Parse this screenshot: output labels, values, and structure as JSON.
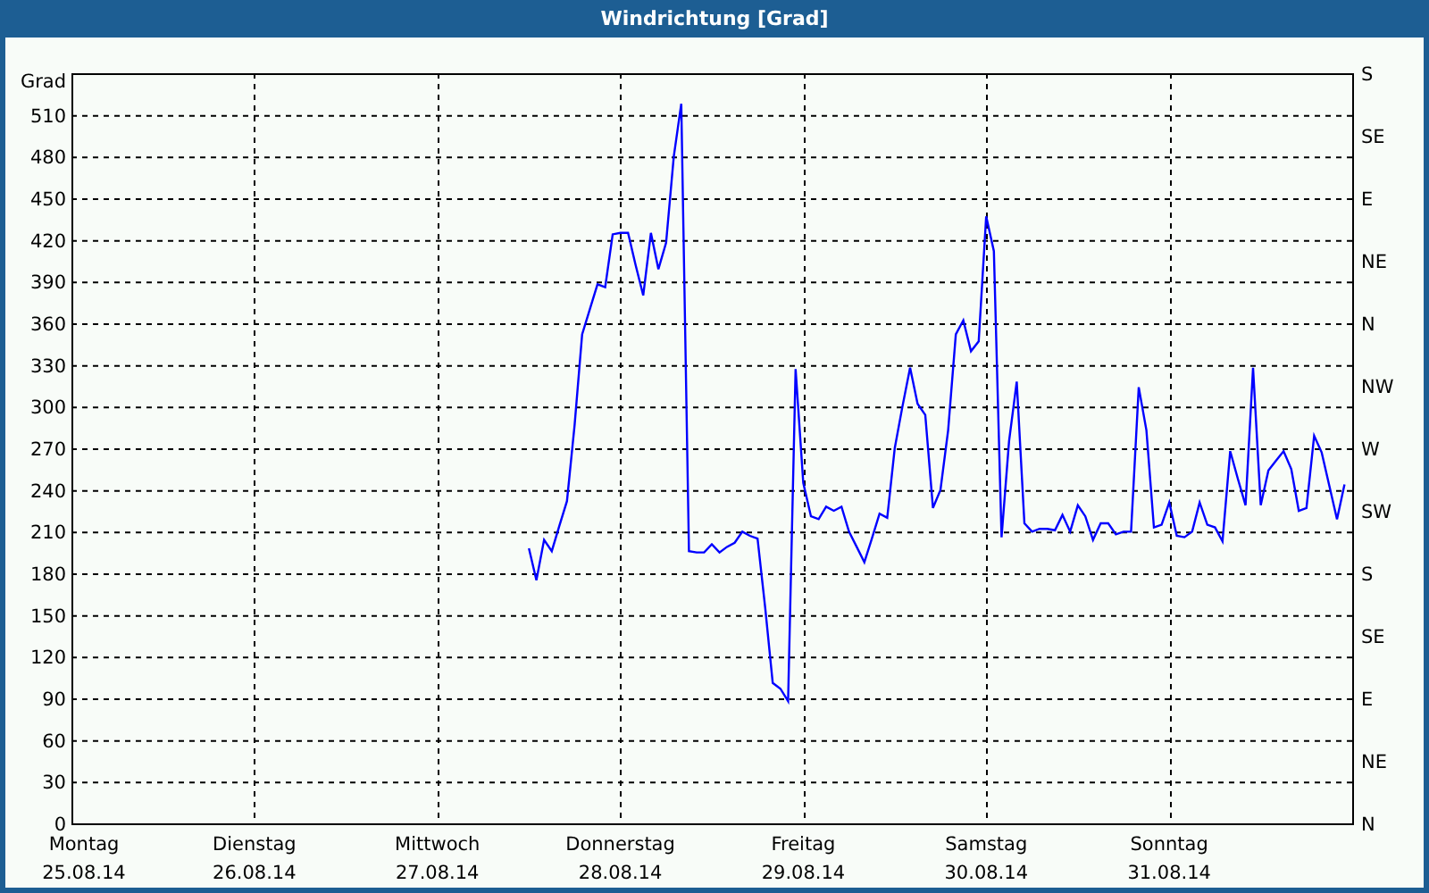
{
  "window": {
    "title": "Windrichtung [Grad]"
  },
  "x_axis_dates": [
    "25.08.14",
    "26.08.14",
    "27.08.14",
    "28.08.14",
    "29.08.14",
    "30.08.14",
    "31.08.14"
  ],
  "compass_labels": [
    "S",
    "SE",
    "E",
    "NE",
    "N",
    "NW",
    "W",
    "SW",
    "S",
    "SE",
    "E",
    "NE",
    "N"
  ],
  "chart_data": {
    "type": "line",
    "grid": true,
    "ylabel": "Grad",
    "ylim": [
      0,
      540
    ],
    "yticks": [
      0,
      30,
      60,
      90,
      120,
      150,
      180,
      210,
      240,
      270,
      300,
      330,
      360,
      390,
      420,
      450,
      480,
      510
    ],
    "categories": [
      "Montag",
      null,
      null,
      null,
      null,
      null,
      null,
      null,
      null,
      null,
      null,
      null,
      null,
      null,
      null,
      null,
      null,
      null,
      null,
      null,
      null,
      null,
      null,
      null,
      "Dienstag",
      null,
      null,
      null,
      null,
      null,
      null,
      null,
      null,
      null,
      null,
      null,
      null,
      null,
      null,
      null,
      null,
      null,
      null,
      null,
      null,
      null,
      null,
      null,
      "Mittwoch",
      null,
      null,
      null,
      null,
      null,
      null,
      null,
      null,
      null,
      null,
      null,
      null,
      null,
      null,
      null,
      null,
      null,
      null,
      null,
      null,
      null,
      null,
      null,
      "Donnerstag",
      null,
      null,
      null,
      null,
      null,
      null,
      null,
      null,
      null,
      null,
      null,
      null,
      null,
      null,
      null,
      null,
      null,
      null,
      null,
      null,
      null,
      null,
      null,
      "Freitag",
      null,
      null,
      null,
      null,
      null,
      null,
      null,
      null,
      null,
      null,
      null,
      null,
      null,
      null,
      null,
      null,
      null,
      null,
      null,
      null,
      null,
      null,
      null,
      "Samstag",
      null,
      null,
      null,
      null,
      null,
      null,
      null,
      null,
      null,
      null,
      null,
      null,
      null,
      null,
      null,
      null,
      null,
      null,
      null,
      null,
      null,
      null,
      null,
      "Sonntag",
      null,
      null,
      null,
      null,
      null,
      null,
      null,
      null,
      null,
      null,
      null,
      null,
      null,
      null,
      null,
      null,
      null,
      null,
      null,
      null,
      null,
      null,
      null
    ],
    "series": [
      {
        "color": "#0000ff",
        "values": [
          null,
          null,
          null,
          null,
          null,
          null,
          null,
          null,
          null,
          null,
          null,
          null,
          null,
          null,
          null,
          null,
          null,
          null,
          null,
          null,
          null,
          null,
          null,
          null,
          null,
          null,
          null,
          null,
          null,
          null,
          null,
          null,
          null,
          null,
          null,
          null,
          null,
          null,
          null,
          null,
          null,
          null,
          null,
          null,
          null,
          null,
          null,
          null,
          null,
          null,
          null,
          null,
          null,
          null,
          null,
          null,
          null,
          null,
          null,
          null,
          198,
          175,
          204,
          196,
          214,
          232,
          287,
          352,
          370,
          388,
          386,
          424,
          425,
          425,
          402,
          380,
          425,
          399,
          418,
          480,
          518,
          196,
          195,
          195,
          201,
          195,
          199,
          202,
          210,
          207,
          205,
          155,
          101,
          97,
          88,
          327,
          245,
          221,
          219,
          228,
          225,
          228,
          210,
          199,
          188,
          205,
          223,
          220,
          270,
          300,
          328,
          302,
          294,
          227,
          240,
          283,
          352,
          362,
          340,
          347,
          437,
          412,
          206,
          275,
          318,
          216,
          210,
          212,
          212,
          211,
          222,
          210,
          229,
          221,
          204,
          216,
          216,
          208,
          210,
          210,
          314,
          283,
          213,
          215,
          231,
          207,
          206,
          210,
          231,
          215,
          213,
          203,
          268,
          248,
          229,
          328,
          229,
          254,
          261,
          268,
          255,
          225,
          227,
          279,
          267,
          243,
          219,
          244
        ]
      }
    ]
  }
}
